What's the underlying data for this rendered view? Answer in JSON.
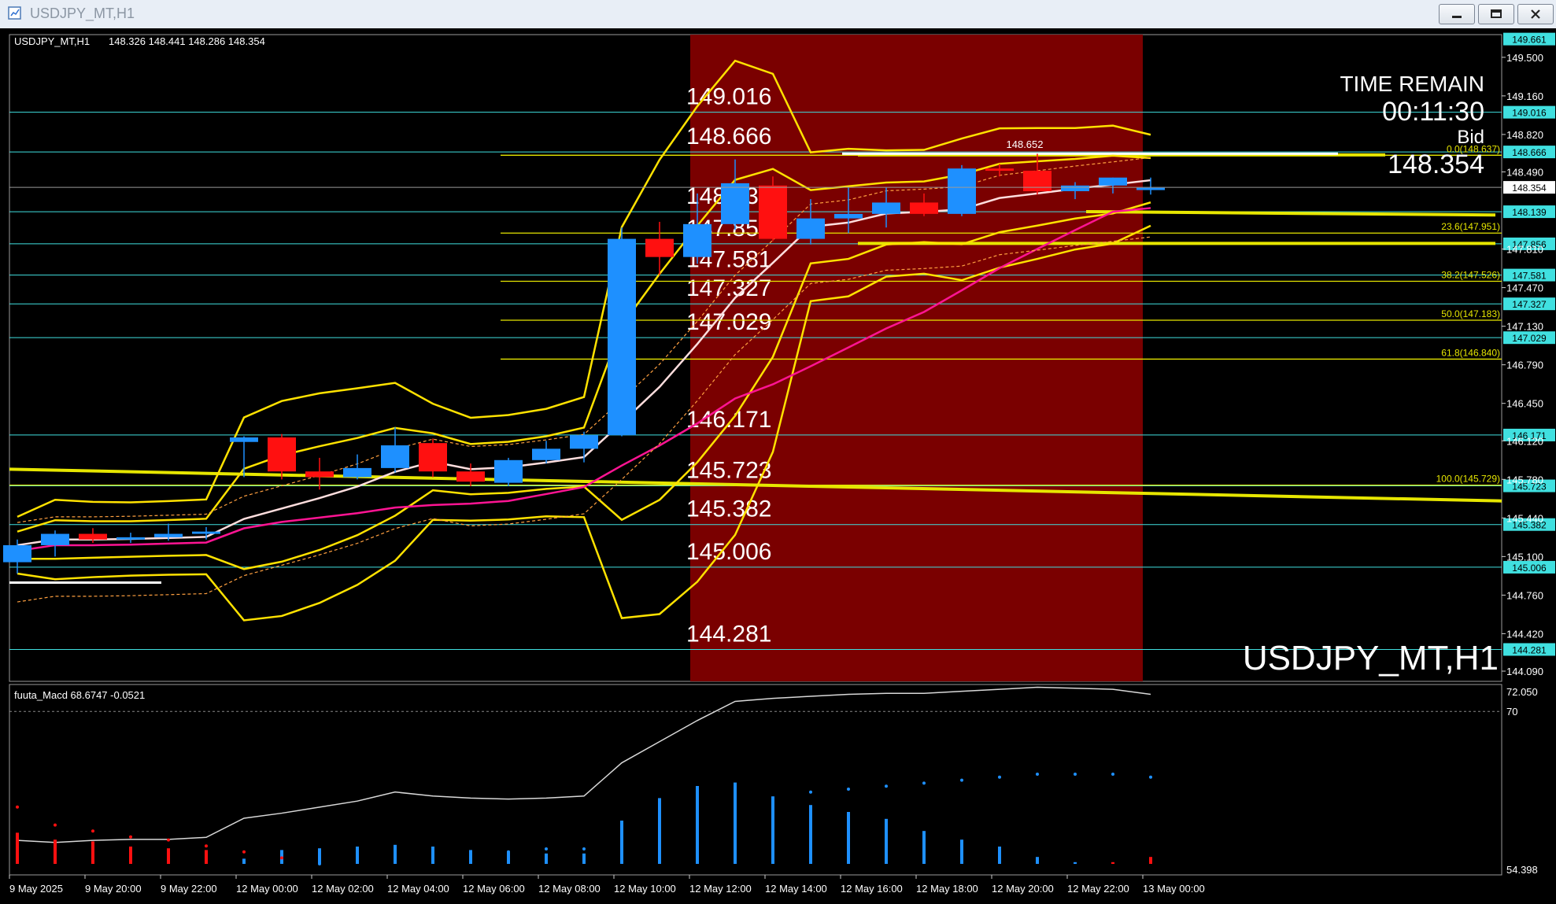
{
  "window": {
    "title": "USDJPY_MT,H1",
    "minimize_icon": "minimize-icon",
    "restore_icon": "restore-icon",
    "close_icon": "close-icon"
  },
  "chart_data": {
    "type": "candlestick",
    "symbol_label": "USDJPY_MT,H1",
    "ohlc_readout": "148.326 148.441 148.286 148.354",
    "watermark": "USDJPY_MT,H1",
    "time_remain": {
      "label": "TIME REMAIN",
      "value": "00:11:30",
      "price_label": "Bid",
      "price": "148.354"
    },
    "colors": {
      "background": "#000000",
      "bull": "#1e90ff",
      "bear": "#ff1010",
      "highlight": "#7a0000",
      "level_line": "#40e0e0",
      "fib_line": "#e6e600",
      "bollinger": "#ffe200",
      "ma_slow": "#ff1493",
      "ma_fast": "#ffdede",
      "macd_up": "#1e90ff",
      "macd_down": "#ff1010"
    },
    "y_range": [
      144.0,
      149.7
    ],
    "price_axis_ticks": [
      "149.500",
      "149.160",
      "148.820",
      "148.490",
      "147.810",
      "147.470",
      "147.130",
      "146.790",
      "146.450",
      "146.120",
      "145.780",
      "145.440",
      "145.100",
      "144.760",
      "144.420",
      "144.090"
    ],
    "time_labels": [
      "9 May 2025",
      "9 May 20:00",
      "9 May 22:00",
      "12 May 00:00",
      "12 May 02:00",
      "12 May 04:00",
      "12 May 06:00",
      "12 May 08:00",
      "12 May 10:00",
      "12 May 12:00",
      "12 May 14:00",
      "12 May 16:00",
      "12 May 18:00",
      "12 May 20:00",
      "12 May 22:00",
      "13 May 00:00"
    ],
    "candles": [
      {
        "o": 145.05,
        "h": 145.25,
        "l": 144.95,
        "c": 145.2
      },
      {
        "o": 145.2,
        "h": 145.33,
        "l": 145.1,
        "c": 145.3
      },
      {
        "o": 145.3,
        "h": 145.35,
        "l": 145.22,
        "c": 145.25
      },
      {
        "o": 145.25,
        "h": 145.31,
        "l": 145.22,
        "c": 145.27
      },
      {
        "o": 145.27,
        "h": 145.39,
        "l": 145.24,
        "c": 145.3
      },
      {
        "o": 145.3,
        "h": 145.36,
        "l": 145.25,
        "c": 145.32
      },
      {
        "o": 146.11,
        "h": 146.16,
        "l": 145.8,
        "c": 146.15
      },
      {
        "o": 146.15,
        "h": 146.18,
        "l": 145.78,
        "c": 145.85
      },
      {
        "o": 145.85,
        "h": 145.97,
        "l": 145.69,
        "c": 145.8
      },
      {
        "o": 145.8,
        "h": 146.0,
        "l": 145.78,
        "c": 145.88
      },
      {
        "o": 145.88,
        "h": 146.24,
        "l": 145.84,
        "c": 146.08
      },
      {
        "o": 146.1,
        "h": 146.14,
        "l": 145.8,
        "c": 145.85
      },
      {
        "o": 145.85,
        "h": 145.92,
        "l": 145.72,
        "c": 145.76
      },
      {
        "o": 145.75,
        "h": 145.97,
        "l": 145.72,
        "c": 145.95
      },
      {
        "o": 145.95,
        "h": 146.12,
        "l": 145.92,
        "c": 146.05
      },
      {
        "o": 146.05,
        "h": 146.2,
        "l": 145.93,
        "c": 146.17
      },
      {
        "o": 146.17,
        "h": 148.0,
        "l": 146.16,
        "c": 147.9
      },
      {
        "o": 147.9,
        "h": 148.05,
        "l": 147.58,
        "c": 147.74
      },
      {
        "o": 147.74,
        "h": 148.3,
        "l": 147.68,
        "c": 148.03
      },
      {
        "o": 148.03,
        "h": 148.6,
        "l": 147.98,
        "c": 148.39
      },
      {
        "o": 148.37,
        "h": 148.45,
        "l": 147.88,
        "c": 147.9
      },
      {
        "o": 147.9,
        "h": 148.25,
        "l": 147.85,
        "c": 148.08
      },
      {
        "o": 148.08,
        "h": 148.35,
        "l": 147.95,
        "c": 148.12
      },
      {
        "o": 148.12,
        "h": 148.35,
        "l": 148.0,
        "c": 148.22
      },
      {
        "o": 148.22,
        "h": 148.3,
        "l": 148.1,
        "c": 148.12
      },
      {
        "o": 148.12,
        "h": 148.55,
        "l": 148.1,
        "c": 148.52
      },
      {
        "o": 148.52,
        "h": 148.56,
        "l": 148.45,
        "c": 148.5
      },
      {
        "o": 148.5,
        "h": 148.65,
        "l": 148.29,
        "c": 148.32
      },
      {
        "o": 148.32,
        "h": 148.4,
        "l": 148.25,
        "c": 148.37
      },
      {
        "o": 148.37,
        "h": 148.44,
        "l": 148.3,
        "c": 148.44
      },
      {
        "o": 148.33,
        "h": 148.44,
        "l": 148.29,
        "c": 148.35
      }
    ],
    "levels": [
      "149.016",
      "148.666",
      "148.139",
      "147.856",
      "147.581",
      "147.327",
      "147.029",
      "146.171",
      "145.723",
      "145.382",
      "145.006",
      "144.281"
    ],
    "fibonacci": [
      {
        "label": "0.0(148.637)",
        "price": 148.637
      },
      {
        "label": "23.6(147.951)",
        "price": 147.951
      },
      {
        "label": "38.2(147.526)",
        "price": 147.526
      },
      {
        "label": "50.0(147.183)",
        "price": 147.183
      },
      {
        "label": "61.8(146.840)",
        "price": 146.84
      },
      {
        "label": "100.0(145.729)",
        "price": 145.729
      }
    ],
    "high_marker": "148.652",
    "current_price_tag": "148.354",
    "top_price_tag": "149.661",
    "macd": {
      "label": "fuuta_Macd 68.6747  -0.0521",
      "y_range": [
        54.398,
        72.05
      ],
      "axis_labels": [
        "72.050",
        "70",
        "54.398"
      ],
      "line": [
        57.2,
        57.0,
        57.2,
        57.3,
        57.3,
        57.5,
        59.4,
        59.9,
        60.5,
        61.1,
        62.0,
        61.6,
        61.4,
        61.3,
        61.4,
        61.6,
        64.9,
        67.0,
        69.1,
        71.0,
        71.3,
        71.5,
        71.7,
        71.8,
        71.8,
        72.0,
        72.2,
        72.4,
        72.3,
        72.2,
        71.7
      ],
      "histogram": [
        -1.8,
        -1.4,
        -1.3,
        -1.0,
        -0.9,
        -0.8,
        0.3,
        0.8,
        0.9,
        1.0,
        1.1,
        1.0,
        0.8,
        0.7,
        0.6,
        0.6,
        2.5,
        3.8,
        4.5,
        4.7,
        3.9,
        3.4,
        3.0,
        2.6,
        1.9,
        1.4,
        1.0,
        0.4,
        0.1,
        -0.1,
        -0.4
      ],
      "signal": [
        -1.9,
        -1.3,
        -1.1,
        -0.9,
        -0.8,
        -0.6,
        -0.4,
        -0.2,
        0.0,
        0.1,
        0.2,
        0.3,
        0.4,
        0.4,
        0.5,
        0.5,
        0.8,
        1.2,
        1.6,
        2.0,
        2.2,
        2.4,
        2.5,
        2.6,
        2.7,
        2.8,
        2.9,
        3.0,
        3.0,
        3.0,
        2.9
      ]
    }
  }
}
